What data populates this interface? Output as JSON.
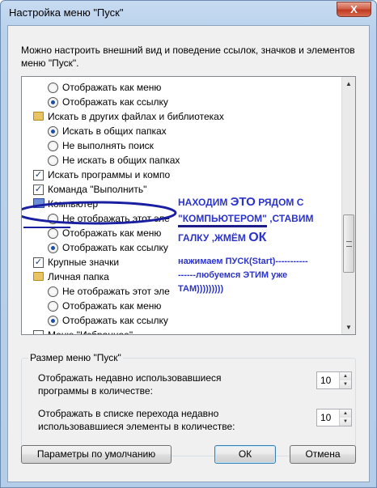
{
  "window": {
    "title": "Настройка меню \"Пуск\"",
    "close_glyph": "X"
  },
  "intro_text": "Можно настроить внешний вид и поведение ссылок, значков и элементов меню \"Пуск\".",
  "list": {
    "items": [
      {
        "kind": "radio",
        "checked": false,
        "label": "Отображать как меню"
      },
      {
        "kind": "radio",
        "checked": true,
        "label": "Отображать как ссылку"
      },
      {
        "kind": "folder",
        "label": "Искать в других файлах и библиотеках"
      },
      {
        "kind": "radio",
        "checked": true,
        "label": "Искать в общих папках"
      },
      {
        "kind": "radio",
        "checked": false,
        "label": "Не выполнять поиск"
      },
      {
        "kind": "radio",
        "checked": false,
        "label": "Не искать в общих папках"
      },
      {
        "kind": "check",
        "checked": true,
        "label": "Искать программы и компо"
      },
      {
        "kind": "check",
        "checked": true,
        "label": "Команда \"Выполнить\""
      },
      {
        "kind": "computer",
        "label": "Компьютер"
      },
      {
        "kind": "radio",
        "checked": false,
        "label": "Не отображать этот эле"
      },
      {
        "kind": "radio",
        "checked": false,
        "label": "Отображать как меню"
      },
      {
        "kind": "radio",
        "checked": true,
        "label": "Отображать как ссылку"
      },
      {
        "kind": "check",
        "checked": true,
        "label": "Крупные значки"
      },
      {
        "kind": "folder",
        "label": "Личная папка"
      },
      {
        "kind": "radio",
        "checked": false,
        "label": "Не отображать этот эле"
      },
      {
        "kind": "radio",
        "checked": false,
        "label": "Отображать как меню"
      },
      {
        "kind": "radio",
        "checked": true,
        "label": "Отображать как ссылку"
      },
      {
        "kind": "check",
        "checked": false,
        "label": "Меню \"Избранное\""
      }
    ]
  },
  "annotation": {
    "line1_a": "НАХОДИМ ",
    "line1_b": "ЭТО",
    "line1_c": " РЯДОМ С",
    "line2_a": "\"КОМПЬЮТЕРОМ\"",
    "line2_b": " ,СТАВИМ",
    "line3_a": "ГАЛКУ ,ЖМЁМ ",
    "line3_b": "ОК",
    "para_line1": "нажимаем ПУСК(Start)-----------",
    "para_line2": "------любуемся ЭТИМ уже",
    "para_line3": "ТАМ)))))))))"
  },
  "size_group": {
    "label": "Размер меню \"Пуск\"",
    "row1_label_line1": "Отображать недавно использовавшиеся",
    "row1_label_line2": "программы в количестве:",
    "row1_value": "10",
    "row2_label_line1": "Отображать в списке перехода недавно",
    "row2_label_line2": "использовавшиеся элементы в количестве:",
    "row2_value": "10"
  },
  "buttons": {
    "defaults": "Параметры по умолчанию",
    "ok": "ОК",
    "cancel": "Отмена"
  },
  "colors": {
    "annotation": "#2b33c9",
    "selection_outline": "#2b33c9"
  }
}
